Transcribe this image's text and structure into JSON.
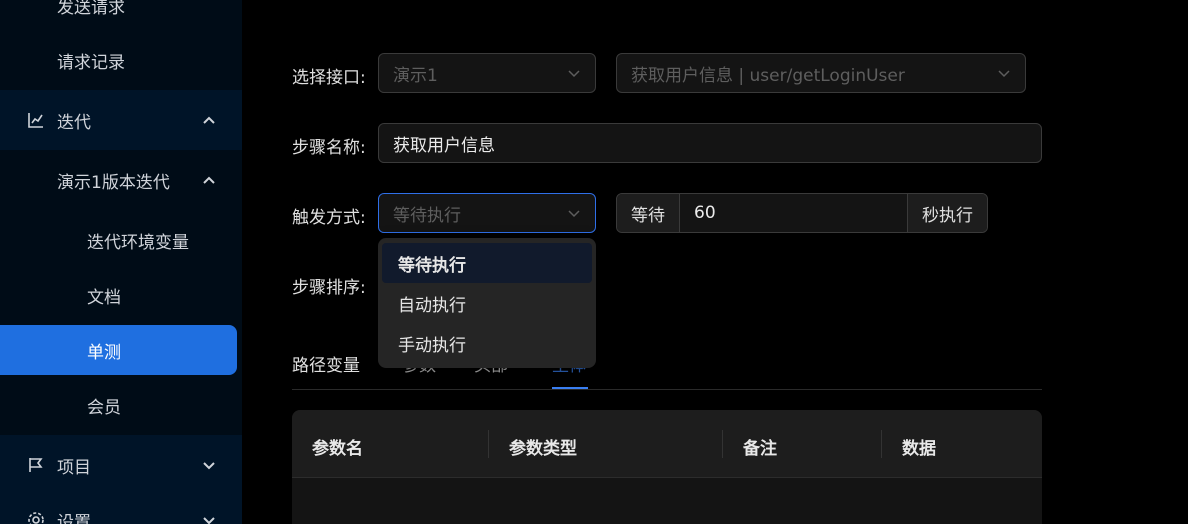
{
  "sidebar": {
    "items": [
      {
        "label": "发送请求"
      },
      {
        "label": "请求记录"
      },
      {
        "label": "迭代",
        "icon": "line-chart-icon"
      },
      {
        "label": "演示1版本迭代"
      },
      {
        "label": "迭代环境变量"
      },
      {
        "label": "文档"
      },
      {
        "label": "单测"
      },
      {
        "label": "会员"
      },
      {
        "label": "项目",
        "icon": "flag-icon"
      },
      {
        "label": "设置",
        "icon": "gear-icon"
      }
    ],
    "active_color": "#1f6fe0"
  },
  "form": {
    "interface_label": "选择接口:",
    "module_value": "演示1",
    "api_value": "获取用户信息 | user/getLoginUser",
    "step_name_label": "步骤名称:",
    "step_name_value": "获取用户信息",
    "trigger_label": "触发方式:",
    "trigger_placeholder": "等待执行",
    "wait_prefix": "等待",
    "wait_value": "60",
    "wait_suffix": "秒执行",
    "order_label": "步骤排序:"
  },
  "dropdown": {
    "options": [
      "等待执行",
      "自动执行",
      "手动执行"
    ],
    "selected": "等待执行"
  },
  "tabs": {
    "items": [
      "路径变量",
      "参数",
      "头部",
      "主体"
    ],
    "active": "主体",
    "active_color": "#3b82f6"
  },
  "table": {
    "columns": [
      "参数名",
      "参数类型",
      "备注",
      "数据"
    ]
  }
}
